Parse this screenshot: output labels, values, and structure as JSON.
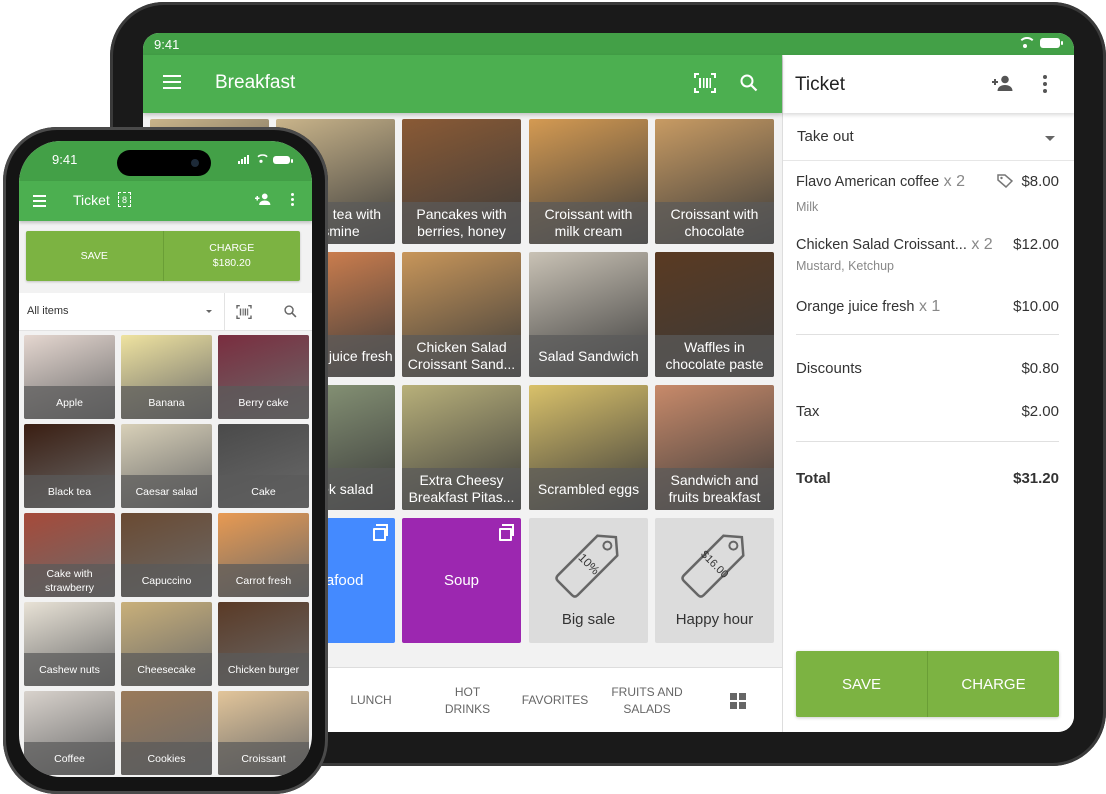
{
  "colors": {
    "primary_green": "#4caf50",
    "status_green": "#43a047",
    "action_green": "#7cb342",
    "seafood_blue": "#448aff",
    "soup_purple": "#9c27b0",
    "discount_gray": "#dcdcdc"
  },
  "tablet": {
    "status_time": "9:41",
    "appbar": {
      "title": "Breakfast",
      "menu_icon": "hamburger-menu-icon",
      "barcode_icon": "barcode-scan-icon",
      "search_icon": "search-icon"
    },
    "items": [
      {
        "label": "Green tea with jasmine",
        "visible_label": "tea with\nsmine",
        "color": "#c9b48a"
      },
      {
        "label": "Pancakes with berries, honey",
        "color": "#8a5a35"
      },
      {
        "label": "Croissant with milk cream",
        "color": "#d49a52"
      },
      {
        "label": "Croissant with chocolate",
        "color": "#c89b63"
      },
      {
        "label": "Orange juice fresh",
        "visible_label": "ge juice\nresh",
        "color": "#dc8550"
      },
      {
        "label": "Chicken Salad Croissant Sand...",
        "color": "#c8965a"
      },
      {
        "label": "Salad Sandwich",
        "color": "#c9c2b5"
      },
      {
        "label": "Waffles in chocolate paste",
        "color": "#5a3a22"
      },
      {
        "label": "Greek salad",
        "visible_label": "ek salad",
        "color": "#8c9a7a"
      },
      {
        "label": "Extra Cheesy Breakfast Pitas...",
        "color": "#b8b07a"
      },
      {
        "label": "Scrambled eggs",
        "color": "#d9c16a"
      },
      {
        "label": "Sandwich and fruits breakfast",
        "color": "#c88a6a"
      }
    ],
    "categories": [
      {
        "label": "Seafood",
        "visible_label": "afood",
        "color": "#448aff"
      },
      {
        "label": "Soup",
        "color": "#9c27b0"
      }
    ],
    "discounts": [
      {
        "label": "Big sale",
        "tag_text": "10%"
      },
      {
        "label": "Happy hour",
        "tag_text": "$16.00"
      }
    ],
    "bottom_nav": [
      {
        "label": "LUNCH"
      },
      {
        "label": "HOT\nDRINKS"
      },
      {
        "label": "FAVORITES"
      },
      {
        "label": "FRUITS AND\nSALADS"
      }
    ],
    "bottom_nav_grid_icon": "grid-view-icon",
    "ticket": {
      "title": "Ticket",
      "dining_option": "Take out",
      "lines": [
        {
          "name": "Flavo American coffee",
          "qty": "x 2",
          "price": "$8.00",
          "modifier": "Milk",
          "discount_tag": true
        },
        {
          "name": "Chicken Salad Croissant...",
          "qty": "x 2",
          "price": "$12.00",
          "modifier": "Mustard, Ketchup",
          "discount_tag": false
        },
        {
          "name": "Orange juice fresh",
          "qty": "x 1",
          "price": "$10.00",
          "modifier": "",
          "discount_tag": false
        }
      ],
      "discounts_label": "Discounts",
      "discounts_value": "$0.80",
      "tax_label": "Tax",
      "tax_value": "$2.00",
      "total_label": "Total",
      "total_value": "$31.20",
      "save_label": "SAVE",
      "charge_label": "CHARGE"
    }
  },
  "phone": {
    "status_time": "9:41",
    "appbar": {
      "title": "Ticket",
      "badge_count": "8"
    },
    "save_label": "SAVE",
    "charge_label": "CHARGE",
    "charge_amount": "$180.20",
    "filter_value": "All items",
    "items": [
      {
        "label": "Apple",
        "color": "#e5d7d0"
      },
      {
        "label": "Banana",
        "color": "#efe3a0"
      },
      {
        "label": "Berry cake",
        "color": "#7a2d3f"
      },
      {
        "label": "Black tea",
        "color": "#3a1e12"
      },
      {
        "label": "Caesar salad",
        "color": "#d8d0b8"
      },
      {
        "label": "Cake",
        "color": "#4a4a4a"
      },
      {
        "label": "Cake with strawberry",
        "color": "#a64a3a"
      },
      {
        "label": "Capuccino",
        "color": "#6a4a32"
      },
      {
        "label": "Carrot fresh",
        "color": "#e89a52"
      },
      {
        "label": "Cashew nuts",
        "color": "#e8e2d6"
      },
      {
        "label": "Cheesecake",
        "color": "#c9b07a"
      },
      {
        "label": "Chicken burger",
        "color": "#5a3a26"
      },
      {
        "label": "Coffee",
        "color": "#d8d2cc"
      },
      {
        "label": "Cookies",
        "color": "#9a7a5a"
      },
      {
        "label": "Croissant",
        "color": "#e2c59a"
      }
    ]
  }
}
